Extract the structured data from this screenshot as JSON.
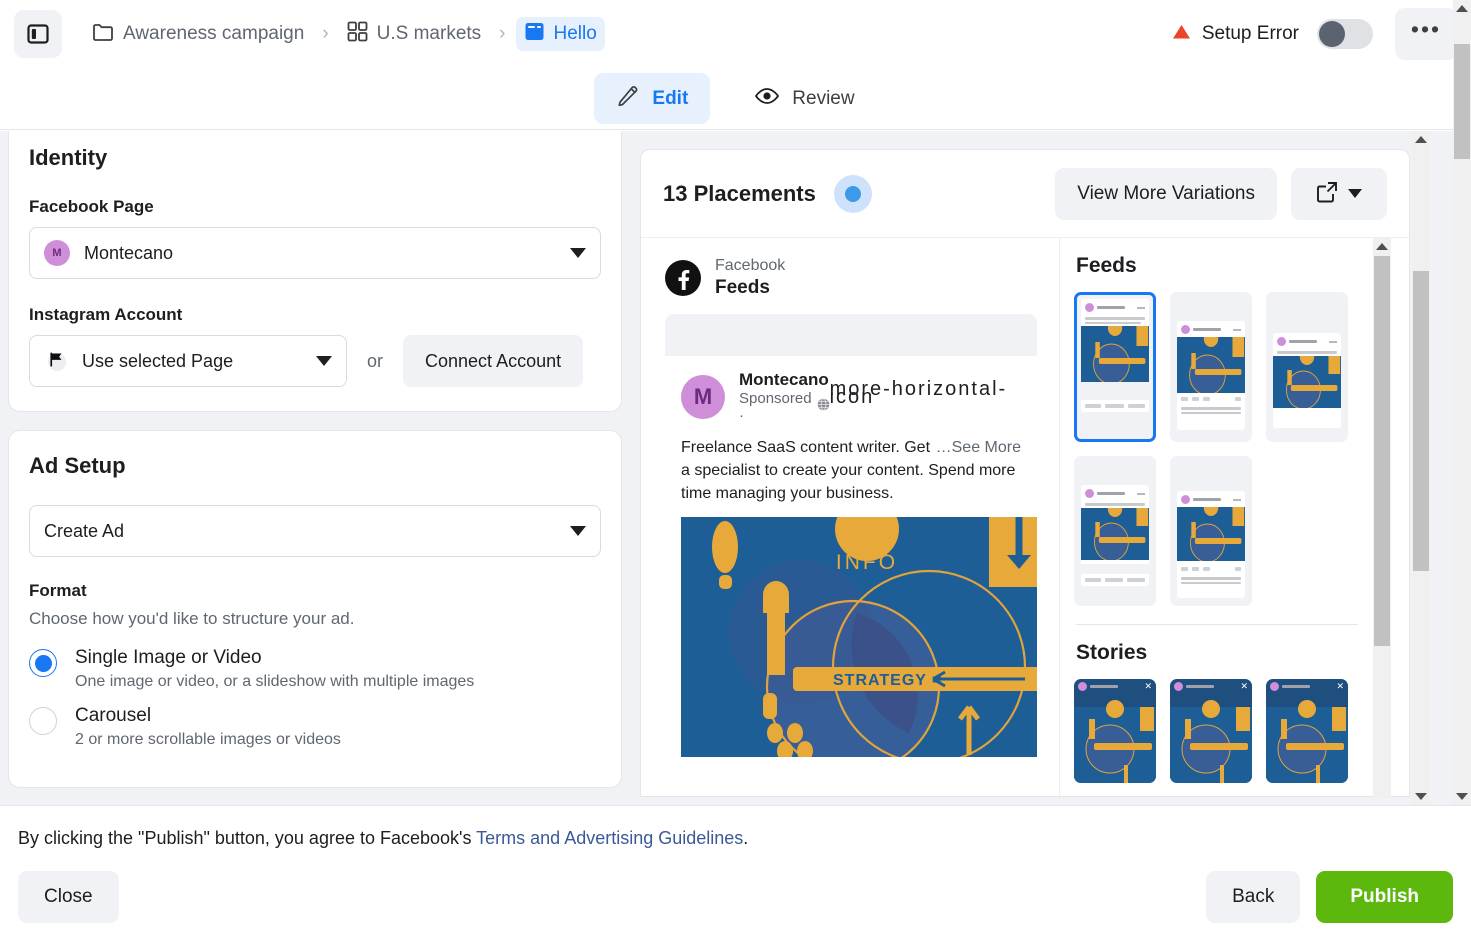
{
  "topbar": {
    "panel_toggle_icon": "sidebar-panel-icon",
    "breadcrumb": [
      {
        "label": "Awareness campaign",
        "icon": "folder-icon",
        "active": false
      },
      {
        "label": "U.S markets",
        "icon": "grid-icon",
        "active": false
      },
      {
        "label": "Hello",
        "icon": "ad-icon",
        "active": true
      }
    ],
    "separator": "›",
    "status": {
      "label": "Setup Error",
      "icon": "warning-triangle-icon",
      "color": "#e8452c"
    },
    "toggle": {
      "name": "setup-error-toggle",
      "state": "off"
    },
    "more_label": "•••"
  },
  "tabs": [
    {
      "label": "Edit",
      "icon": "pencil-icon",
      "active": true
    },
    {
      "label": "Review",
      "icon": "eye-icon",
      "active": false
    }
  ],
  "identity": {
    "title": "Identity",
    "facebook_page_label": "Facebook Page",
    "facebook_page_value": "Montecano",
    "facebook_page_avatar": "M",
    "instagram_label": "Instagram Account",
    "instagram_value": "Use selected Page",
    "instagram_icon": "instagram-page-icon",
    "or_text": "or",
    "connect_button": "Connect Account"
  },
  "ad_setup": {
    "title": "Ad Setup",
    "create_select_value": "Create Ad",
    "format_label": "Format",
    "format_helper": "Choose how you'd like to structure your ad.",
    "options": [
      {
        "title": "Single Image or Video",
        "desc": "One image or video, or a slideshow with multiple images",
        "checked": true
      },
      {
        "title": "Carousel",
        "desc": "2 or more scrollable images or videos",
        "checked": false
      }
    ]
  },
  "preview": {
    "placements_count": "13 Placements",
    "view_more_button": "View More Variations",
    "export_icon": "external-link-icon",
    "export_caret_icon": "chevron-down-icon",
    "platform": {
      "icon": "facebook-icon",
      "network": "Facebook",
      "surface": "Feeds"
    },
    "ad": {
      "page_name": "Montecano",
      "avatar_letter": "M",
      "meta": "Sponsored ·",
      "globe_icon": "globe-icon",
      "body": "Freelance SaaS content writer. Get a specialist to create your content. Spend more time managing your business.",
      "see_more": "…See More",
      "more_icon": "more-horizontal-icon",
      "image_alt_text": [
        "INFO",
        "STRATEGY ="
      ]
    },
    "rail": {
      "feeds_title": "Feeds",
      "stories_title": "Stories",
      "feeds_thumbs": [
        {
          "name": "Montecano",
          "selected": true,
          "style": "feed"
        },
        {
          "name": "Montecano",
          "selected": false,
          "style": "ig"
        },
        {
          "name": "Montecano",
          "selected": false,
          "style": "plain"
        },
        {
          "name": "Montecano",
          "selected": false,
          "style": "feed"
        },
        {
          "name": "Montecano",
          "selected": false,
          "style": "ig"
        }
      ],
      "stories_thumbs": [
        {
          "name": "Montecano",
          "close_icon": "close-icon"
        },
        {
          "name": "Montecano",
          "close_icon": "close-icon"
        },
        {
          "name": "Montecano",
          "close_icon": "close-icon"
        }
      ]
    }
  },
  "bottom": {
    "legal_prefix": "By clicking the \"Publish\" button, you agree to Facebook's ",
    "legal_link": "Terms and Advertising Guidelines",
    "legal_suffix": ".",
    "close_label": "Close",
    "back_label": "Back",
    "publish_label": "Publish",
    "publish_color": "#5cb80d"
  }
}
